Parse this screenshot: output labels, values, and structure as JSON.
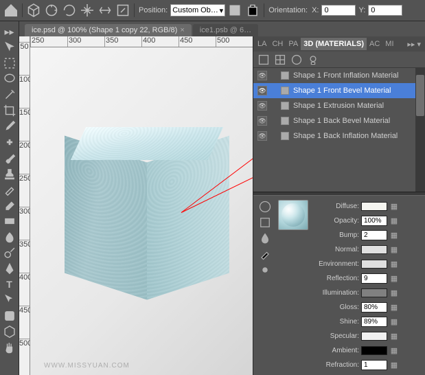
{
  "topbar": {
    "position_label": "Position:",
    "position_dropdown": "Custom Ob…",
    "orientation_label": "Orientation:",
    "x_label": "X:",
    "x_value": "0",
    "y_label": "Y:",
    "y_value": "0"
  },
  "tabs": {
    "doc1": "ice.psd @ 100% (Shape 1 copy 22, RGB/8)",
    "doc2": "ice1.psb @ 6…"
  },
  "ruler_h": [
    "250",
    "300",
    "350",
    "400",
    "450",
    "500"
  ],
  "ruler_v": [
    "50",
    "100",
    "150",
    "200",
    "250",
    "300",
    "350",
    "400",
    "450",
    "500"
  ],
  "watermark": "WWW.MISSYUAN.COM",
  "panel_tabs": [
    "LA",
    "CH",
    "PA",
    "3D (MATERIALS)",
    "AC",
    "MI"
  ],
  "materials": [
    {
      "name": "Shape 1 Front Inflation Material",
      "sel": false
    },
    {
      "name": "Shape 1 Front Bevel Material",
      "sel": true
    },
    {
      "name": "Shape 1 Extrusion Material",
      "sel": false
    },
    {
      "name": "Shape 1 Back Bevel Material",
      "sel": false
    },
    {
      "name": "Shape 1 Back Inflation Material",
      "sel": false
    }
  ],
  "props": {
    "diffuse_label": "Diffuse:",
    "diffuse_color": "#f5f5f0",
    "opacity_label": "Opacity:",
    "opacity_value": "100%",
    "bump_label": "Bump:",
    "bump_value": "2",
    "normal_label": "Normal:",
    "normal_color": "#e0e0e0",
    "environment_label": "Environment:",
    "environment_color": "#e0e0e0",
    "reflection_label": "Reflection:",
    "reflection_value": "9",
    "illumination_label": "Illumination:",
    "illumination_color": "#808080",
    "gloss_label": "Gloss:",
    "gloss_value": "80%",
    "shine_label": "Shine:",
    "shine_value": "89%",
    "specular_label": "Specular:",
    "specular_color": "#f0f0f0",
    "ambient_label": "Ambient:",
    "ambient_color": "#000000",
    "refraction_label": "Refraction:",
    "refraction_value": "1"
  }
}
